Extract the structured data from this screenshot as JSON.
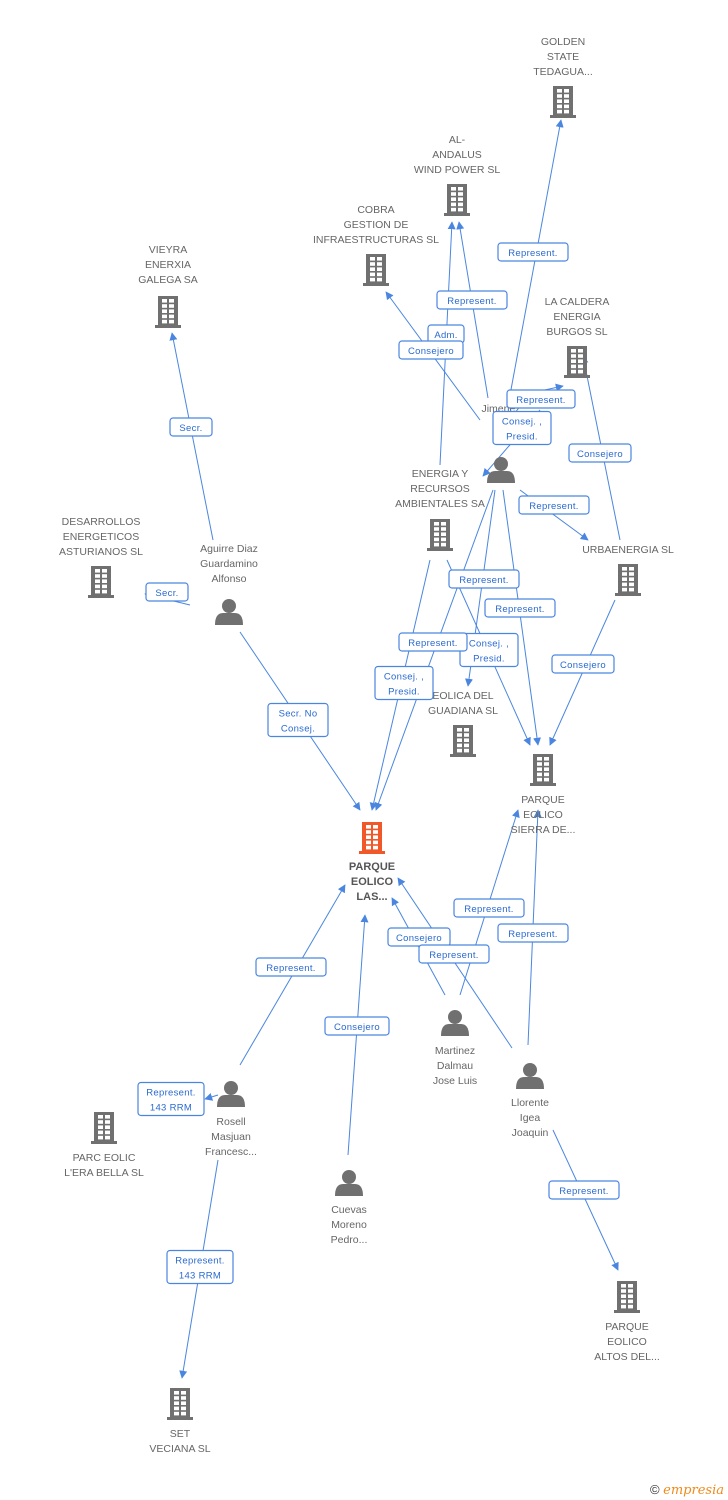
{
  "colors": {
    "edge": "#4a86e0",
    "node": "#707070",
    "main_node": "#f0582a",
    "brand": "#f08a1c"
  },
  "main_node": {
    "id": "main",
    "lines": [
      "PARQUE",
      "EOLICO",
      "LAS..."
    ]
  },
  "companies": [
    {
      "id": "golden",
      "lines": [
        "GOLDEN",
        "STATE",
        "TEDAGUA..."
      ]
    },
    {
      "id": "alandalus",
      "lines": [
        "AL-",
        "ANDALUS",
        "WIND POWER SL"
      ]
    },
    {
      "id": "cobra",
      "lines": [
        "COBRA",
        "GESTION DE",
        "INFRAESTRUCTURAS SL"
      ]
    },
    {
      "id": "vieyra",
      "lines": [
        "VIEYRA",
        "ENERXIA",
        "GALEGA SA"
      ]
    },
    {
      "id": "lacaldera",
      "lines": [
        "LA CALDERA",
        "ENERGIA",
        "BURGOS SL"
      ]
    },
    {
      "id": "energia",
      "lines": [
        "ENERGIA Y",
        "RECURSOS",
        "AMBIENTALES SA"
      ]
    },
    {
      "id": "desarrollos",
      "lines": [
        "DESARROLLOS",
        "ENERGETICOS",
        "ASTURIANOS SL"
      ]
    },
    {
      "id": "urbaenergia",
      "lines": [
        "URBAENERGIA SL"
      ]
    },
    {
      "id": "guadiana",
      "lines": [
        "EOLICA DEL",
        "GUADIANA SL"
      ]
    },
    {
      "id": "sierra",
      "lines": [
        "PARQUE",
        "EOLICO",
        "SIERRA DE..."
      ]
    },
    {
      "id": "parceolic",
      "lines": [
        "PARC EOLIC",
        "L'ERA BELLA SL"
      ]
    },
    {
      "id": "altos",
      "lines": [
        "PARQUE",
        "EOLICO",
        "ALTOS DEL..."
      ]
    },
    {
      "id": "veciana",
      "lines": [
        "SET",
        "VECIANA SL"
      ]
    }
  ],
  "persons": [
    {
      "id": "jimenez",
      "lines": [
        "Jimenez",
        "Se",
        "Ra"
      ]
    },
    {
      "id": "aguirre",
      "lines": [
        "Aguirre Diaz",
        "Guardamino",
        "Alfonso"
      ]
    },
    {
      "id": "martinez",
      "lines": [
        "Martinez",
        "Dalmau",
        "Jose Luis"
      ]
    },
    {
      "id": "llorente",
      "lines": [
        "Llorente",
        "Igea",
        "Joaquin"
      ]
    },
    {
      "id": "rosell",
      "lines": [
        "Rosell",
        "Masjuan",
        "Francesc..."
      ]
    },
    {
      "id": "cuevas",
      "lines": [
        "Cuevas",
        "Moreno",
        "Pedro..."
      ]
    }
  ],
  "relations": [
    {
      "from": "jimenez",
      "to": "golden",
      "label": [
        "Represent."
      ]
    },
    {
      "from": "jimenez",
      "to": "alandalus",
      "label": [
        "Represent."
      ]
    },
    {
      "from": "energia",
      "to": "alandalus",
      "label": [
        "Adm."
      ]
    },
    {
      "from": "jimenez",
      "to": "cobra",
      "label": [
        "Consejero"
      ]
    },
    {
      "from": "jimenez",
      "to": "lacaldera",
      "label": [
        "Represent."
      ]
    },
    {
      "from": "lacaldera",
      "to": "jimenez",
      "label": [
        "Consej. ,",
        "Presid."
      ]
    },
    {
      "from": "urbaenergia",
      "to": "lacaldera",
      "label": [
        "Consejero"
      ]
    },
    {
      "from": "jimenez",
      "to": "urbaenergia",
      "label": [
        "Represent."
      ]
    },
    {
      "from": "energia",
      "to": "sierra",
      "label": [
        "Represent."
      ]
    },
    {
      "from": "jimenez",
      "to": "sierra",
      "label": [
        "Represent."
      ]
    },
    {
      "from": "jimenez",
      "to": "guadiana",
      "label": [
        "Consej. ,",
        "Presid."
      ]
    },
    {
      "from": "jimenez",
      "to": "main",
      "label": [
        "Represent."
      ]
    },
    {
      "from": "energia",
      "to": "main",
      "label": [
        "Consej. ,",
        "Presid."
      ]
    },
    {
      "from": "urbaenergia",
      "to": "sierra",
      "label": [
        "Consejero"
      ]
    },
    {
      "from": "aguirre",
      "to": "vieyra",
      "label": [
        "Secr."
      ]
    },
    {
      "from": "aguirre",
      "to": "desarrollos",
      "label": [
        "Secr."
      ]
    },
    {
      "from": "aguirre",
      "to": "main",
      "label": [
        "Secr.  No",
        "Consej."
      ]
    },
    {
      "from": "rosell",
      "to": "main",
      "label": [
        "Represent."
      ]
    },
    {
      "from": "cuevas",
      "to": "main",
      "label": [
        "Consejero"
      ]
    },
    {
      "from": "martinez",
      "to": "main",
      "label": [
        "Consejero"
      ]
    },
    {
      "from": "martinez",
      "to": "sierra",
      "label": [
        "Represent."
      ]
    },
    {
      "from": "llorente",
      "to": "main",
      "label": [
        "Represent."
      ]
    },
    {
      "from": "llorente",
      "to": "sierra",
      "label": [
        "Represent."
      ]
    },
    {
      "from": "llorente",
      "to": "altos",
      "label": [
        "Represent."
      ]
    },
    {
      "from": "rosell",
      "to": "veciana",
      "label": [
        "Represent.",
        "143 RRM"
      ]
    },
    {
      "from": "rosell",
      "to": "parceolic",
      "label": [
        "Represent.",
        "143 RRM"
      ]
    }
  ],
  "footer": {
    "copyright": "©",
    "brand": "empresia"
  }
}
